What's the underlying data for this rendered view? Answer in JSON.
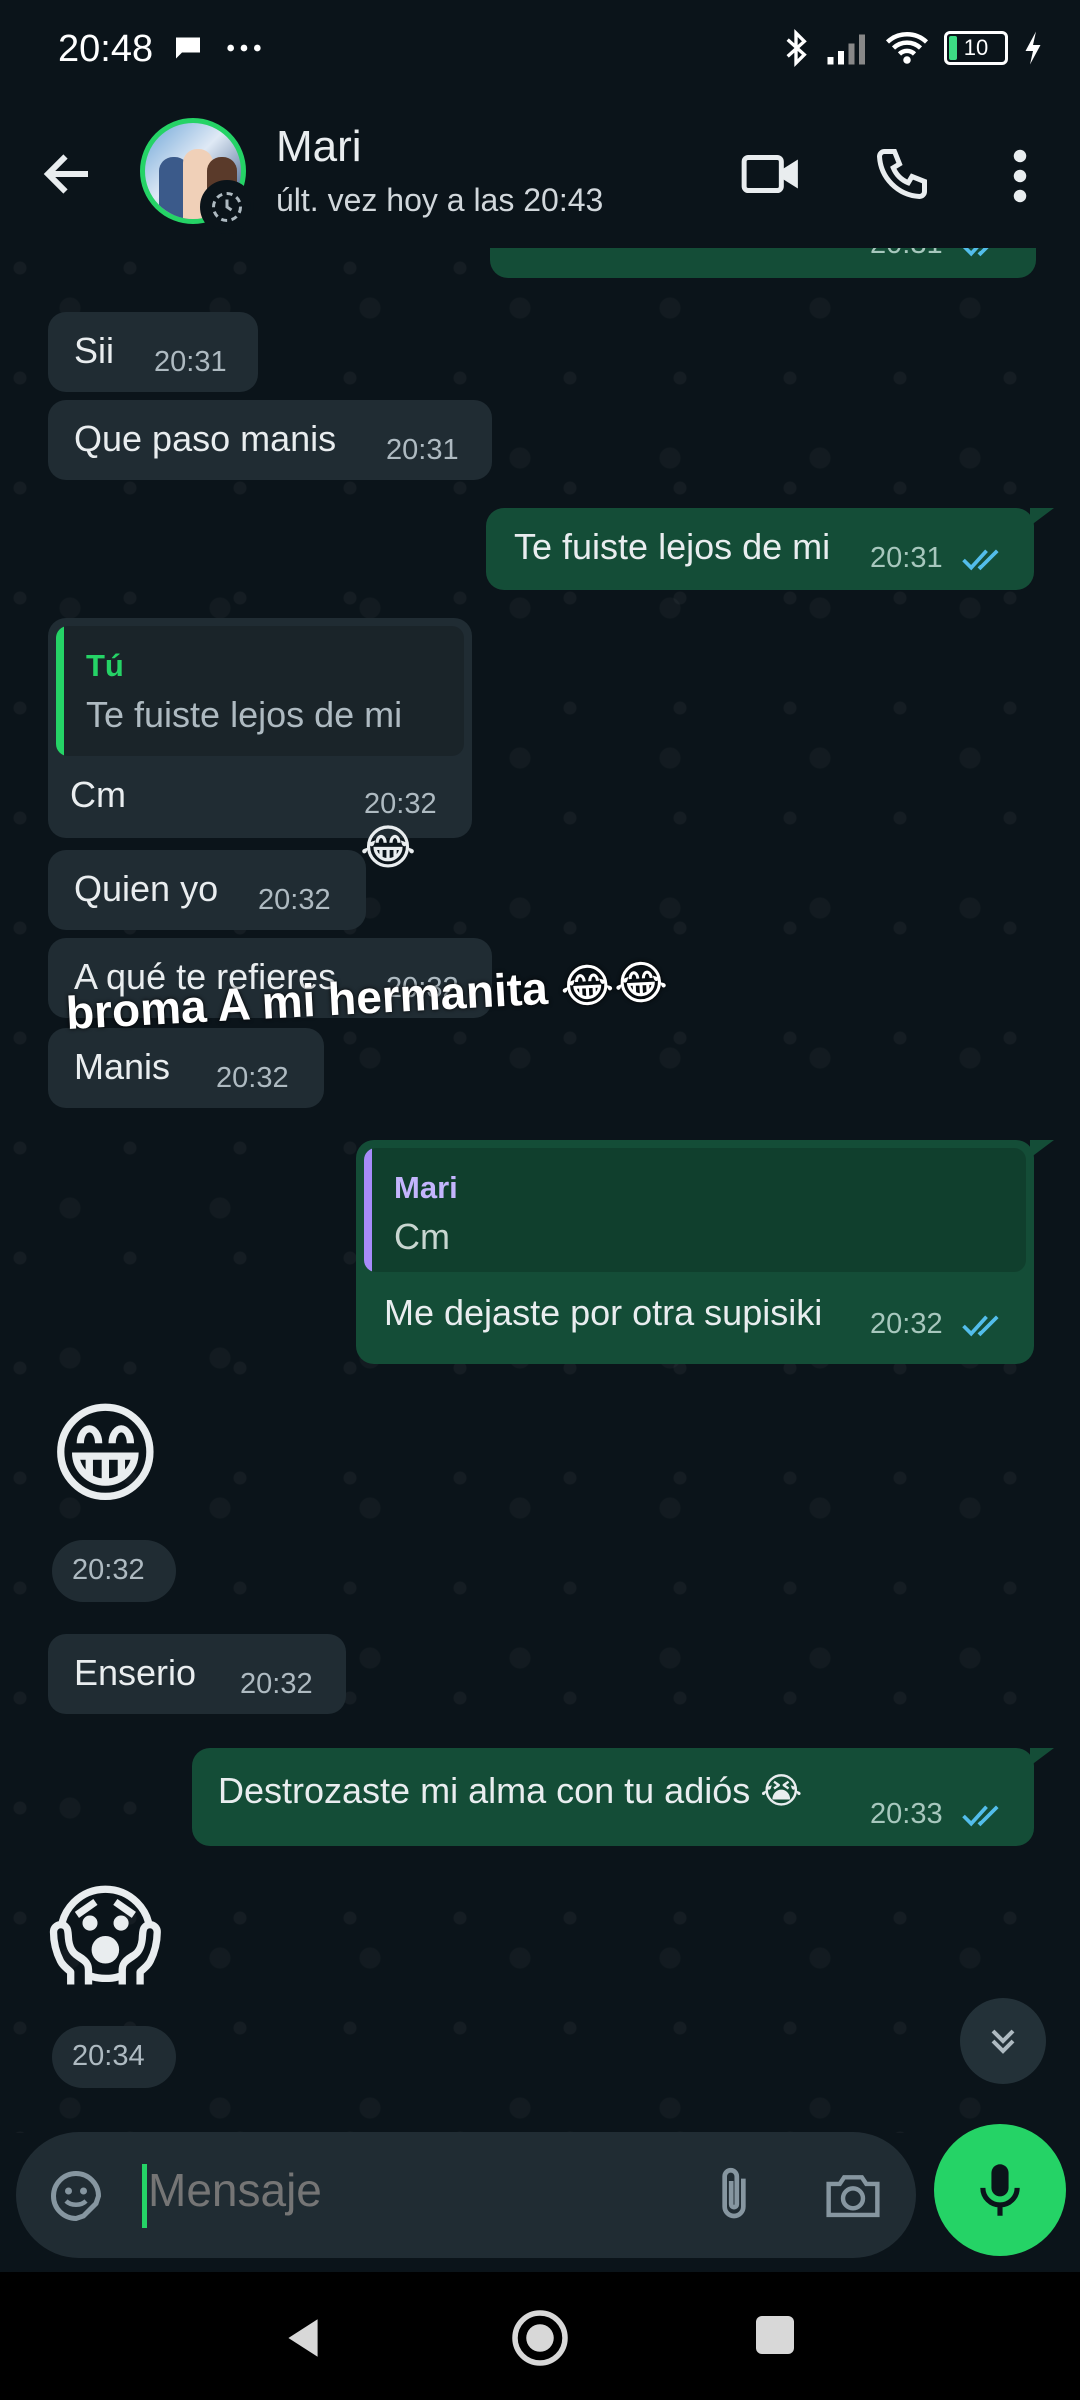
{
  "status_bar": {
    "time": "20:48",
    "left_icons": [
      "chat-bubble-icon",
      "more-dots-icon"
    ],
    "right_icons": [
      "bluetooth-icon",
      "signal-icon",
      "wifi-icon",
      "battery-icon",
      "charging-icon"
    ],
    "battery_level": "10"
  },
  "header": {
    "contact_name": "Mari",
    "last_seen": "últ. vez hoy a las 20:43",
    "icons": [
      "back-arrow-icon",
      "video-call-icon",
      "phone-icon",
      "more-vert-icon"
    ]
  },
  "messages": [
    {
      "dir": "in",
      "text": "Sii",
      "time": "20:31"
    },
    {
      "dir": "in",
      "text": "Que paso manis",
      "time": "20:31"
    },
    {
      "dir": "out",
      "text": "Te fuiste lejos de mi",
      "time": "20:31",
      "read": true
    },
    {
      "dir": "in",
      "quote_name": "Tú",
      "quote_text": "Te fuiste lejos de mi",
      "text": "Cm",
      "time": "20:32"
    },
    {
      "dir": "in",
      "text": "Quien yo",
      "time": "20:32"
    },
    {
      "dir": "in",
      "text": "A qué te refieres",
      "time": "20:32"
    },
    {
      "dir": "in",
      "text": "Manis",
      "time": "20:32"
    },
    {
      "dir": "out",
      "quote_name": "Mari",
      "quote_text": "Cm",
      "text": "Me dejaste por otra supisiki",
      "time": "20:32",
      "read": true
    },
    {
      "dir": "in",
      "emoji": "😁",
      "time": "20:32"
    },
    {
      "dir": "in",
      "text": "Enserio",
      "time": "20:32"
    },
    {
      "dir": "out",
      "text": "Destrozaste mi alma con tu adiós 😭",
      "time": "20:33",
      "read": true
    },
    {
      "dir": "in",
      "emoji": "😱",
      "time": "20:34"
    }
  ],
  "top_partial_time": "20:31",
  "overlay_caption": "broma A mi hermanita 😂😂",
  "overlay_caption_emoji": "😂",
  "input": {
    "placeholder": "Mensaje",
    "icons": [
      "emoji-sticker-icon",
      "attach-clip-icon",
      "camera-icon",
      "mic-icon"
    ]
  },
  "colors": {
    "background": "#0b141a",
    "incoming_bubble": "#202c33",
    "outgoing_bubble": "#144d37",
    "accent": "#25d366",
    "read_ticks": "#53bdeb",
    "quote_self": "#25d366",
    "quote_contact": "#a78bfa"
  }
}
